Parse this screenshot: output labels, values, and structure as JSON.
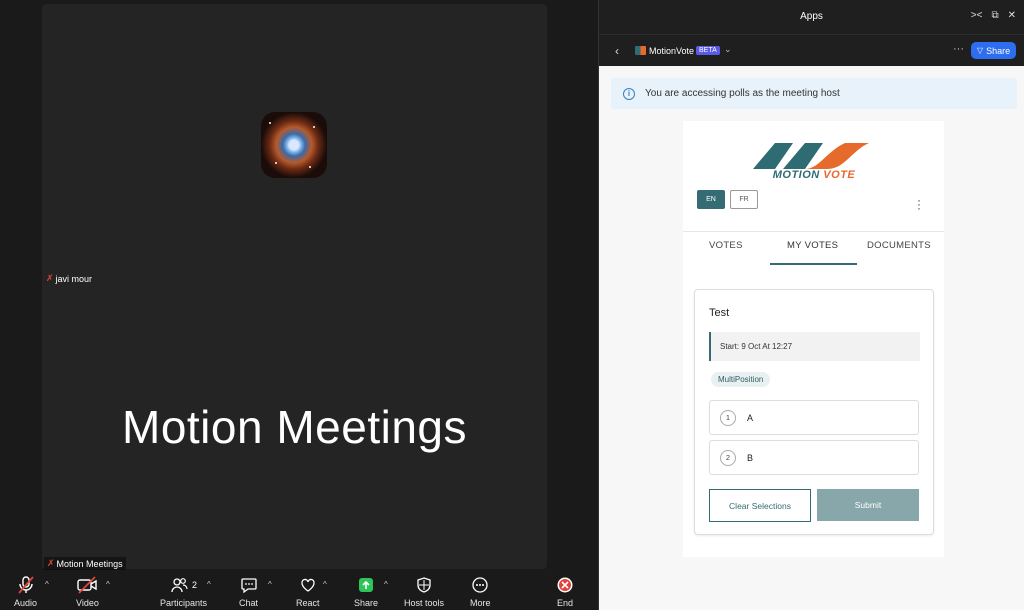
{
  "meeting": {
    "participant_top_label": "javi mour",
    "display_name_large": "Motion Meetings",
    "participant_bottom_label": "Motion Meetings"
  },
  "toolbar": {
    "audio": "Audio",
    "video": "Video",
    "participants": "Participants",
    "participants_count": "2",
    "chat": "Chat",
    "react": "React",
    "share": "Share",
    "host_tools": "Host tools",
    "more": "More",
    "end": "End"
  },
  "panel": {
    "title": "Apps",
    "app_name": "MotionVote",
    "beta_badge": "BETA",
    "share_button": "Share",
    "info_message": "You are accessing polls as the meeting host"
  },
  "motionvote": {
    "logo_word1": "MOTION",
    "logo_word2": "VOTE",
    "lang_en": "EN",
    "lang_fr": "FR",
    "tabs": [
      "VOTES",
      "MY VOTES",
      "DOCUMENTS"
    ],
    "active_tab": "MY VOTES",
    "poll": {
      "title": "Test",
      "start": "Start: 9 Oct At 12:27",
      "type_chip": "MultiPosition",
      "options": [
        {
          "num": "1",
          "label": "A"
        },
        {
          "num": "2",
          "label": "B"
        }
      ],
      "clear_button": "Clear Selections",
      "submit_button": "Submit"
    }
  },
  "colors": {
    "brand_teal": "#356b73",
    "brand_orange": "#e66a2c",
    "share_blue": "#2d6df0",
    "end_red": "#e0433a"
  }
}
